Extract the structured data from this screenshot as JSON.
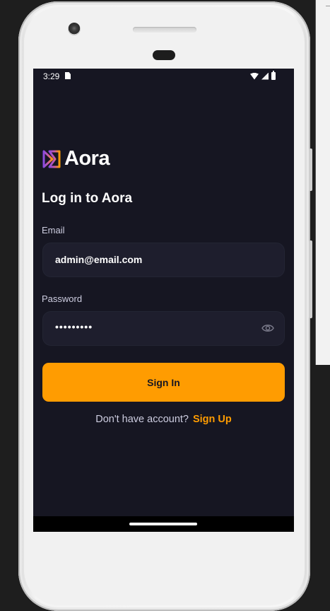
{
  "status_bar": {
    "time": "3:29"
  },
  "app": {
    "logo_text": "Aora"
  },
  "login": {
    "title": "Log in to Aora",
    "email_label": "Email",
    "email_value": "admin@email.com",
    "password_label": "Password",
    "password_value": "•••••••••",
    "signin_label": "Sign In",
    "signup_prompt": "Don't have account?",
    "signup_link": "Sign Up"
  },
  "colors": {
    "background": "#161622",
    "accent": "#FF9C01",
    "field": "#1E1E2D",
    "text_muted": "#CDCDE0"
  },
  "icons": [
    "wifi-icon",
    "signal-icon",
    "battery-icon",
    "sim-card-icon",
    "eye-icon",
    "camera-icon"
  ]
}
